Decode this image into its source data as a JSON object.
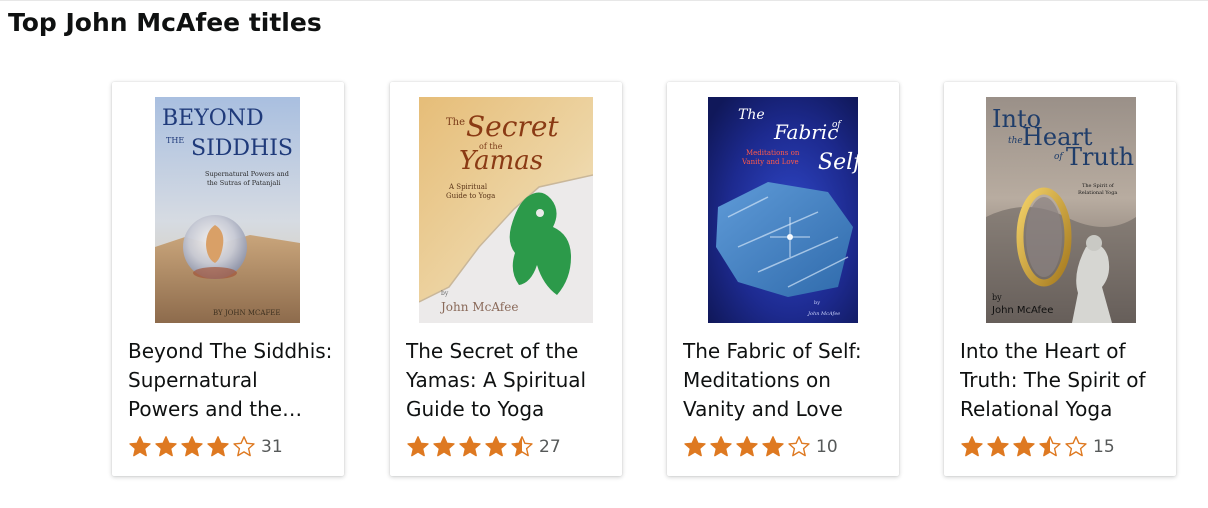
{
  "section": {
    "heading": "Top John McAfee titles"
  },
  "colors": {
    "star": "#de7921",
    "text": "#0f1111",
    "muted": "#565959"
  },
  "books": [
    {
      "title": "Beyond The Siddhis: Supernatural Powers and the Sutras of Patanjali",
      "rating": 4,
      "review_count": "31",
      "cover": {
        "line1": "BEYOND",
        "line2a": "THE",
        "line2b": "SIDDHIS",
        "subtitle1": "Supernatural Powers and",
        "subtitle2": "the Sutras of Patanjali",
        "author": "BY JOHN MCAFEE"
      }
    },
    {
      "title": "The Secret of the Yamas: A Spiritual Guide to Yoga",
      "rating": 4.5,
      "review_count": "27",
      "cover": {
        "the": "The",
        "secret": "Secret",
        "of_the": "of the",
        "yamas": "Yamas",
        "subtitle1": "A Spiritual",
        "subtitle2": "Guide to Yoga",
        "by": "by",
        "author": "John McAfee"
      }
    },
    {
      "title": "The Fabric of Self: Meditations on Vanity and Love",
      "rating": 4,
      "review_count": "10",
      "cover": {
        "the": "The",
        "fabric": "Fabric",
        "of": "of",
        "self": "Self",
        "subtitle1": "Meditations on",
        "subtitle2": "Vanity and Love",
        "by": "by",
        "author": "John McAfee"
      }
    },
    {
      "title": "Into the Heart of Truth: The Spirit of Relational Yoga",
      "rating": 3.5,
      "review_count": "15",
      "cover": {
        "into": "Into",
        "the": "the",
        "heart": "Heart",
        "of": "of",
        "truth": "Truth",
        "subtitle1": "The Spirit of",
        "subtitle2": "Relational Yoga",
        "by": "by",
        "author": "John McAfee"
      }
    }
  ]
}
